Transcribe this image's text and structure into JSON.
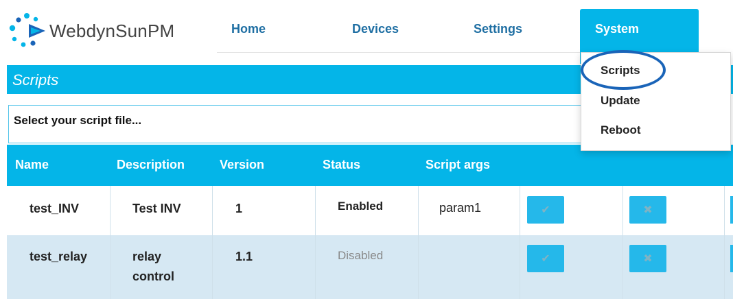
{
  "brand": {
    "name": "WebdynSunPM"
  },
  "nav": {
    "items": [
      {
        "label": "Home"
      },
      {
        "label": "Devices"
      },
      {
        "label": "Settings"
      },
      {
        "label": "System"
      }
    ],
    "active": "System"
  },
  "dropdown": {
    "items": [
      {
        "label": "Scripts"
      },
      {
        "label": "Update"
      },
      {
        "label": "Reboot"
      }
    ],
    "highlighted": "Scripts"
  },
  "page": {
    "title": "Scripts"
  },
  "file_input": {
    "placeholder": "Select your script file..."
  },
  "table": {
    "columns": [
      "Name",
      "Description",
      "Version",
      "Status",
      "Script args"
    ],
    "rows": [
      {
        "name": "test_INV",
        "description": "Test INV",
        "version": "1",
        "status": "Enabled",
        "args": "param1"
      },
      {
        "name": "test_relay",
        "description_line1": "relay",
        "description_line2": "control",
        "version": "1.1",
        "status": "Disabled",
        "args": ""
      }
    ]
  },
  "icons": {
    "enable": "check-icon",
    "disable": "cross-icon"
  },
  "colors": {
    "accent": "#04b5e8",
    "nav_text": "#1f6fa3",
    "highlight_ring": "#1a64b8",
    "row_alt": "#d6e8f3"
  }
}
